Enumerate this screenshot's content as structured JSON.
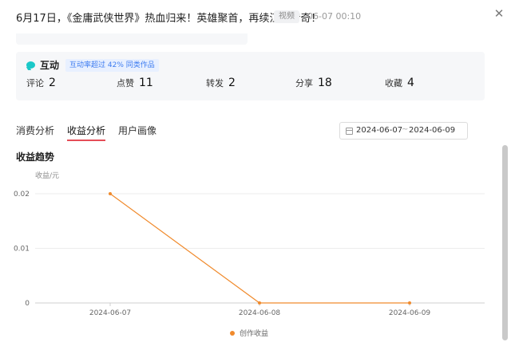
{
  "header": {
    "title": "6月17日，《金庸武侠世界》热血归来！英雄聚首，再续江湖传奇！",
    "type_badge": "视频",
    "time": "06-07 00:10",
    "close_icon": "close-icon"
  },
  "interaction": {
    "icon": "chat-bubble-icon",
    "title": "互动",
    "tag": "互动率超过 42% 同类作品",
    "metrics": [
      {
        "label": "评论",
        "value": "2"
      },
      {
        "label": "点赞",
        "value": "11"
      },
      {
        "label": "转发",
        "value": "2"
      },
      {
        "label": "分享",
        "value": "18"
      },
      {
        "label": "收藏",
        "value": "4"
      }
    ]
  },
  "tabs": [
    {
      "label": "消费分析",
      "active": false
    },
    {
      "label": "收益分析",
      "active": true
    },
    {
      "label": "用户画像",
      "active": false
    }
  ],
  "date_range": {
    "icon": "calendar-icon",
    "start": "2024-06-07",
    "separator": "~",
    "end": "2024-06-09"
  },
  "section_title": "收益趋势",
  "colors": {
    "accent_tab": "#e54d57",
    "series": "#f08a2c",
    "tag_text": "#3d7cf0"
  },
  "chart_data": {
    "type": "line",
    "ylabel": "收益/元",
    "x": [
      "2024-06-07",
      "2024-06-08",
      "2024-06-09"
    ],
    "yticks": [
      "0",
      "0.01",
      "0.02"
    ],
    "ylim": [
      0,
      0.02
    ],
    "grid": true,
    "legend": "bottom-center",
    "series": [
      {
        "name": "创作收益",
        "values": [
          0.02,
          0,
          0
        ]
      }
    ]
  }
}
